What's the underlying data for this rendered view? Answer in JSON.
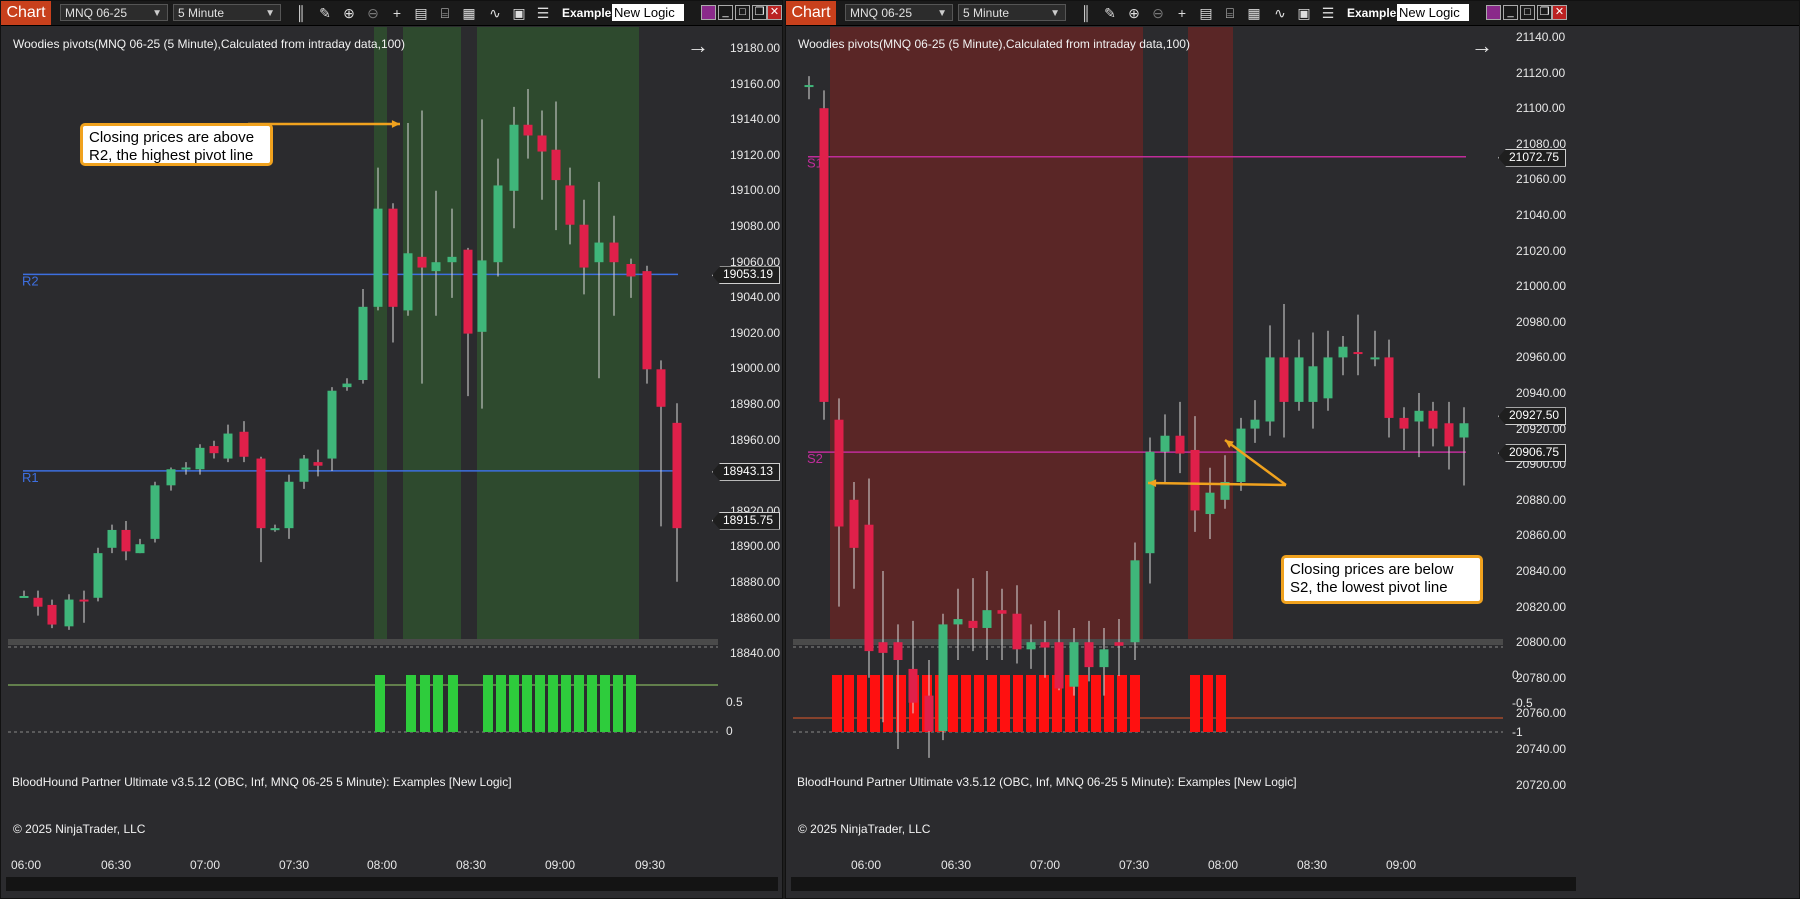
{
  "windows": [
    {
      "tab_label": "Chart",
      "instrument": "MNQ 06-25",
      "interval": "5 Minute",
      "examples_label": "Examples",
      "strategy_input": "New Logic",
      "chart_title": "Woodies pivots(MNQ 06-25 (5 Minute),Calculated from intraday data,100)",
      "indicator_title": "BloodHound Partner Ultimate v3.5.12 (OBC, Inf, MNQ 06-25 5 Minute): Examples  [New Logic]",
      "copyright": "© 2025 NinjaTrader, LLC",
      "price_ticks": [
        "19180.00",
        "19160.00",
        "19140.00",
        "19120.00",
        "19100.00",
        "19080.00",
        "19060.00",
        "19040.00",
        "19020.00",
        "19000.00",
        "18980.00",
        "18960.00",
        "18940.00",
        "18920.00",
        "18900.00",
        "18880.00",
        "18860.00",
        "18840.00"
      ],
      "price_flags": [
        "19053.19",
        "18943.13",
        "18915.75"
      ],
      "indicator_ticks": [
        "0.5",
        "0"
      ],
      "time_ticks": [
        "06:00",
        "06:30",
        "07:00",
        "07:30",
        "08:00",
        "08:30",
        "09:00",
        "09:30"
      ],
      "pivots": [
        {
          "label": "R2",
          "value": 19053.19,
          "color": "#3d6fe0"
        },
        {
          "label": "R1",
          "value": 18943.13,
          "color": "#3d6fe0"
        }
      ],
      "callout": "Closing prices are above R2, the highest pivot line",
      "signal_color": "#2ecc3c",
      "zone_color": "#2e4a2e"
    },
    {
      "tab_label": "Chart",
      "instrument": "MNQ 06-25",
      "interval": "5 Minute",
      "examples_label": "Examples",
      "strategy_input": "New Logic",
      "chart_title": "Woodies pivots(MNQ 06-25 (5 Minute),Calculated from intraday data,100)",
      "indicator_title": "BloodHound Partner Ultimate v3.5.12 (OBC, Inf, MNQ 06-25 5 Minute): Examples  [New Logic]",
      "copyright": "© 2025 NinjaTrader, LLC",
      "price_ticks": [
        "21140.00",
        "21120.00",
        "21100.00",
        "21080.00",
        "21060.00",
        "21040.00",
        "21020.00",
        "21000.00",
        "20980.00",
        "20960.00",
        "20940.00",
        "20920.00",
        "20900.00",
        "20880.00",
        "20860.00",
        "20840.00",
        "20820.00",
        "20800.00",
        "20780.00",
        "20760.00",
        "20740.00",
        "20720.00"
      ],
      "price_flags": [
        "21072.75",
        "20927.50",
        "20906.75"
      ],
      "indicator_ticks": [
        "0",
        "-0.5",
        "-1"
      ],
      "time_ticks": [
        "06:00",
        "06:30",
        "07:00",
        "07:30",
        "08:00",
        "08:30",
        "09:00"
      ],
      "pivots": [
        {
          "label": "S1",
          "value": 21072.75,
          "color": "#c02c9a"
        },
        {
          "label": "S2",
          "value": 20906.75,
          "color": "#c02c9a"
        }
      ],
      "callout": "Closing prices are below S2, the lowest pivot line",
      "signal_color": "#ff1010",
      "zone_color": "#5a2626"
    }
  ],
  "colors": {
    "up_candle": "#3fb67a",
    "down_candle": "#e0204a",
    "callout_border": "#f0a21e",
    "tab_orange": "#c8401c"
  }
}
